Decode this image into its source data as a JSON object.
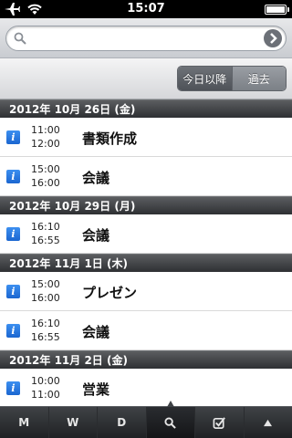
{
  "status": {
    "time": "15:07"
  },
  "search": {
    "placeholder": "",
    "value": ""
  },
  "filter": {
    "options": [
      "今日以降",
      "過去"
    ],
    "selected": "今日以降"
  },
  "sections": [
    {
      "date": "2012年 10月 26日 (金)",
      "events": [
        {
          "start": "11:00",
          "end": "12:00",
          "title": "書類作成"
        },
        {
          "start": "15:00",
          "end": "16:00",
          "title": "会議"
        }
      ]
    },
    {
      "date": "2012年 10月 29日 (月)",
      "events": [
        {
          "start": "16:10",
          "end": "16:55",
          "title": "会議"
        }
      ]
    },
    {
      "date": "2012年 11月 1日 (木)",
      "events": [
        {
          "start": "15:00",
          "end": "16:00",
          "title": "プレゼン"
        },
        {
          "start": "16:10",
          "end": "16:55",
          "title": "会議"
        }
      ]
    },
    {
      "date": "2012年 11月 2日 (金)",
      "events": [
        {
          "start": "10:00",
          "end": "11:00",
          "title": "営業"
        }
      ]
    }
  ],
  "tabbar": {
    "month": "M",
    "week": "W",
    "day": "D"
  },
  "icons": {
    "info": "i",
    "search": "search-icon",
    "checkbox": "checkbox-icon",
    "up": "up-arrow-icon"
  }
}
